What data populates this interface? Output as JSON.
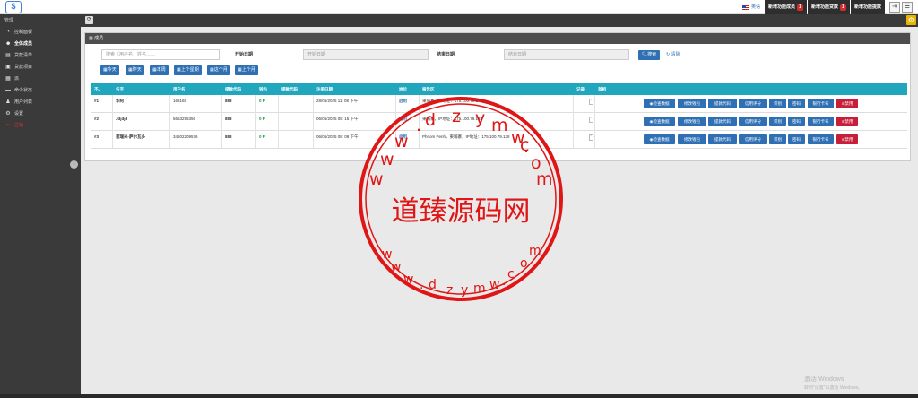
{
  "header": {
    "logo_text": "$",
    "language": "英语",
    "notifications": [
      {
        "label": "新增功能成员",
        "count": "1"
      },
      {
        "label": "新增功能贷款",
        "count": "1"
      },
      {
        "label": "新增功能提款",
        "count": ""
      }
    ]
  },
  "sidebar": {
    "heading": "管理",
    "items": [
      {
        "icon": "dashboard-icon",
        "label": "控制面板"
      },
      {
        "icon": "users-icon",
        "label": "全体成员"
      },
      {
        "icon": "list-icon",
        "label": "贷款清单"
      },
      {
        "icon": "money-icon",
        "label": "贷款项目"
      },
      {
        "icon": "grid-icon",
        "label": "派"
      },
      {
        "icon": "truck-icon",
        "label": "命令状态"
      },
      {
        "icon": "user-icon",
        "label": "用户列表"
      },
      {
        "icon": "gear-icon",
        "label": "设置"
      },
      {
        "icon": "logout-icon",
        "label": "注销"
      }
    ]
  },
  "panel": {
    "title": "成员",
    "search_placeholder": "搜索（用户名，姓名……",
    "start_label": "开始日期",
    "start_placeholder": "开始日期",
    "end_label": "结束日期",
    "end_placeholder": "结束日期",
    "search_button": "搜索",
    "reset_link": "清除",
    "quick_ranges": [
      "今天",
      "昨天",
      "本周",
      "上个星期",
      "这个月",
      "上个月"
    ]
  },
  "table": {
    "columns": [
      "不。",
      "名字",
      "用户名",
      "提款代码",
      "钱包",
      "提款代码",
      "注册日期",
      "地位",
      "报告区",
      "记录",
      "首相"
    ],
    "rows": [
      {
        "no": "#1",
        "name": "华阿",
        "username": "168168",
        "withdraw_code": "888",
        "wallet": "0 ₱",
        "code2": "",
        "date": "28/05/2025 11: 08 下午",
        "status": "启用",
        "report": "東埔寨，IP地址：175.100.79.175"
      },
      {
        "no": "#2",
        "name": "Jdjdjd",
        "username": "5653295356",
        "withdraw_code": "888",
        "wallet": "0 ₱",
        "code2": "",
        "date": "06/06/2025 08: 15 下午",
        "status": "启用",
        "report": "東埔寨，IP地址：175.100.79.133"
      },
      {
        "no": "#3",
        "name": "诺瑞米·萨尔瓦多",
        "username": "34602209576",
        "withdraw_code": "888",
        "wallet": "0 ₱",
        "code2": "",
        "date": "06/06/2025 08: 08 下午",
        "status": "启用",
        "report": "Phnom Penh，東埔寨，IP地址：175.100.79.138"
      }
    ],
    "actions": [
      "检查数据",
      "修改钱包",
      "提款代码",
      "信用评分",
      "识别",
      "密码",
      "银行卡号",
      "禁用"
    ]
  },
  "watermark": {
    "center": "道臻源码网",
    "ring": "www.dzymw.com"
  },
  "os_watermark": {
    "line1": "激活 Windows",
    "line2": "转到\"设置\"以激活 Windows。"
  }
}
